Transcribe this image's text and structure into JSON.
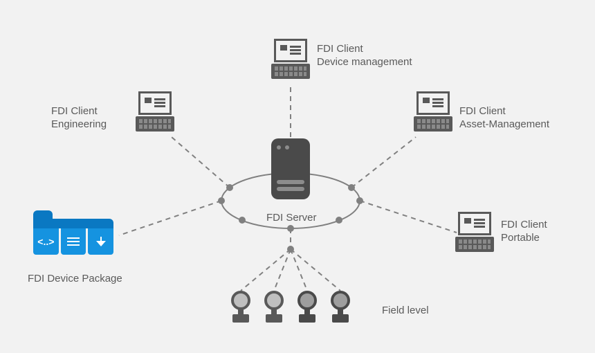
{
  "center": {
    "label": "FDI Server"
  },
  "clients": {
    "engineering": {
      "line1": "FDI Client",
      "line2": "Engineering"
    },
    "device_mgmt": {
      "line1": "FDI Client",
      "line2": "Device management"
    },
    "asset_mgmt": {
      "line1": "FDI Client",
      "line2": "Asset-Management"
    },
    "portable": {
      "line1": "FDI Client",
      "line2": "Portable"
    }
  },
  "package": {
    "label": "FDI Device Package"
  },
  "field": {
    "label": "Field level"
  },
  "colors": {
    "grey_dark": "#4a4a4a",
    "grey_mid": "#595959",
    "blue_dark": "#0a78c2",
    "blue_light": "#1593e0",
    "bg": "#f2f2f2"
  }
}
